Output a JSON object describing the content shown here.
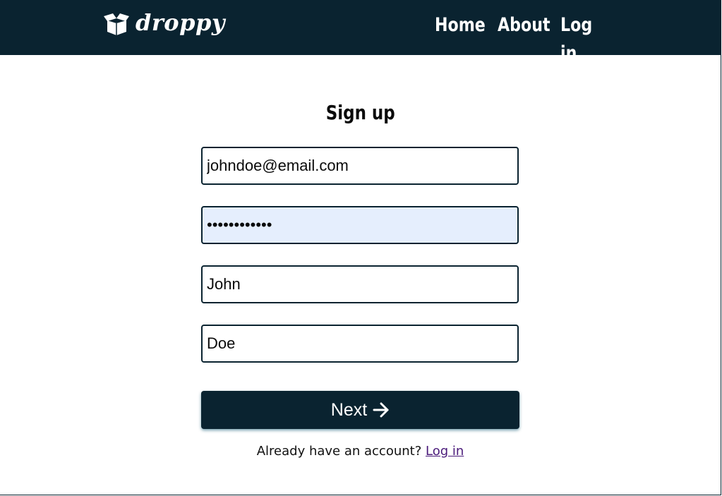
{
  "navbar": {
    "brand": "droppy",
    "links": [
      {
        "label": "Home"
      },
      {
        "label": "About"
      },
      {
        "label": "Log in"
      }
    ]
  },
  "form": {
    "title": "Sign up",
    "email_value": "johndoe@email.com",
    "password_value": "••••••••••••",
    "first_name_value": "John",
    "last_name_value": "Doe",
    "next_label": "Next"
  },
  "footer": {
    "prompt": "Already have an account?",
    "login_link": "Log in"
  },
  "colors": {
    "navbar_bg": "#0a2330",
    "autofill_bg": "#e5eefd",
    "link_visited": "#4a1a7a"
  }
}
